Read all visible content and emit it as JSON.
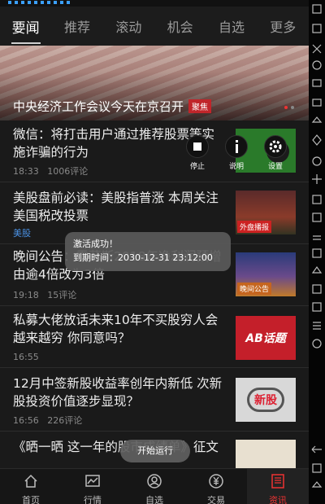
{
  "tabs": [
    "要闻",
    "推荐",
    "滚动",
    "机会",
    "自选",
    "更多"
  ],
  "banner": {
    "caption": "中央经济工作会议今天在京召开",
    "tag": "聚焦"
  },
  "news": [
    {
      "title": "微信：将打击用户通过推荐股票等实施诈骗的行为",
      "time": "18:33",
      "comments": "1006评论",
      "thumb_label": ""
    },
    {
      "title": "美股盘前必读：美股指普涨 本周关注美国税改投票",
      "source": "美股",
      "thumb_label": "外盘播报"
    },
    {
      "title": "晚间公告：雪菲斯2018年净利润预增由逾4倍改为3倍",
      "time": "19:18",
      "comments": "15评论",
      "thumb_label": "晚间公告"
    },
    {
      "title": "私募大佬放话未来10年不买股穷人会越来越穷 你同意吗？",
      "time": "16:55",
      "thumb_label": "AB话题"
    },
    {
      "title": "12月中签新股收益率创年内新低 次新股投资价值逐步显现？",
      "time": "16:56",
      "comments": "226评论",
      "thumb_label": "新股"
    },
    {
      "title": "《晒一晒 这一年的股市成绩单》征文",
      "thumb_label": ""
    }
  ],
  "floater": {
    "stop": "停止",
    "help": "说明",
    "settings": "设置"
  },
  "toast": {
    "line1": "激活成功！",
    "line2": "到期时间：2030-12-31 23:12:00"
  },
  "toast2": "开始运行",
  "bottom_nav": [
    "首页",
    "行情",
    "自选",
    "交易",
    "资讯"
  ],
  "colors": {
    "accent": "#e33333",
    "banner_tag": "#c0252a"
  }
}
